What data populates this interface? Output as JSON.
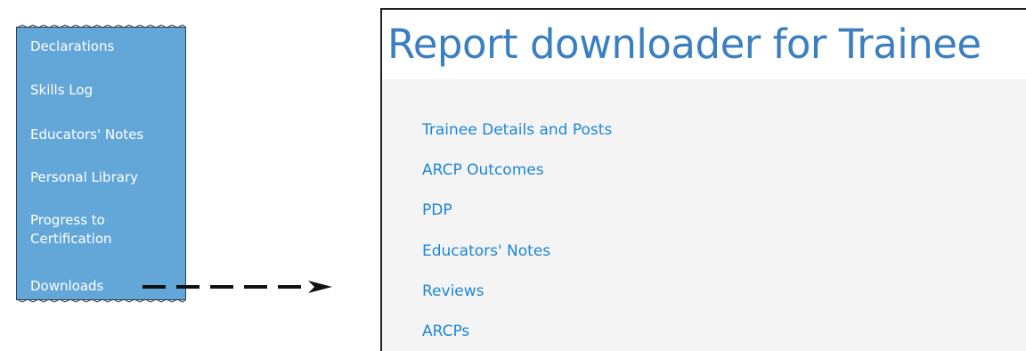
{
  "sidebar": {
    "items": [
      {
        "label": "Declarations"
      },
      {
        "label": "Skills Log"
      },
      {
        "label": "Educators' Notes"
      },
      {
        "label": "Personal Library"
      },
      {
        "label": "Progress to Certification"
      },
      {
        "label": "Downloads"
      }
    ],
    "background_color": "#63a7d8",
    "text_color": "#ffffff"
  },
  "panel": {
    "title": "Report downloader for Trainee",
    "title_color": "#3b7fc0",
    "links": [
      {
        "label": "Trainee Details and Posts"
      },
      {
        "label": "ARCP Outcomes"
      },
      {
        "label": "PDP"
      },
      {
        "label": "Educators' Notes"
      },
      {
        "label": "Reviews"
      },
      {
        "label": "ARCPs"
      }
    ],
    "link_color": "#1e86d6"
  },
  "annotation": {
    "arrow_icon": "dashed-arrow-right-icon"
  }
}
